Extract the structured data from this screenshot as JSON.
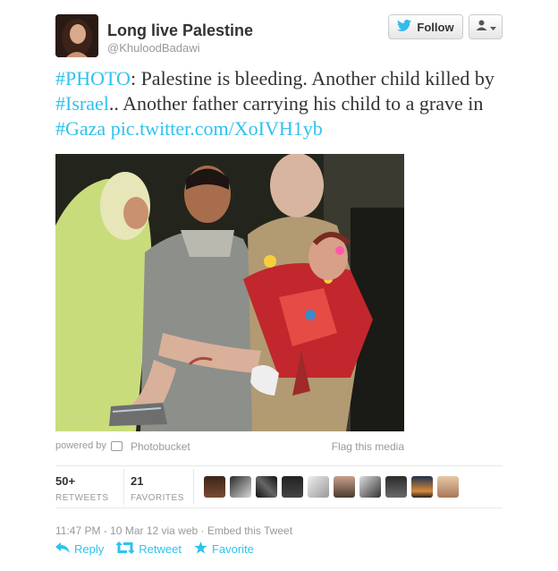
{
  "user": {
    "full_name": "Long live Palestine",
    "username": "@KhuloodBadawi"
  },
  "buttons": {
    "follow_label": "Follow"
  },
  "tweet": {
    "tag_photo": "#PHOTO",
    "text_1": ": Palestine is bleeding. Another child killed by ",
    "tag_israel": "#Israel",
    "text_2": ".. Another father carrying his child to a grave in ",
    "tag_gaza": "#Gaza",
    "link": "pic.twitter.com/XoIVH1yb"
  },
  "media": {
    "powered_by": "powered by",
    "provider": "Photobucket",
    "flag": "Flag this media"
  },
  "stats": {
    "retweets_count": "50+",
    "retweets_label": "RETWEETS",
    "favorites_count": "21",
    "favorites_label": "FAVORITES"
  },
  "meta": {
    "timestamp": "11:47 PM - 10 Mar 12 via web",
    "separator": " · ",
    "embed": "Embed this Tweet"
  },
  "actions": {
    "reply": "Reply",
    "retweet": "Retweet",
    "favorite": "Favorite"
  },
  "colors": {
    "link": "#2fc2ef",
    "twitter_bird": "#33bcec"
  }
}
